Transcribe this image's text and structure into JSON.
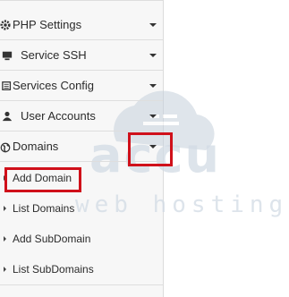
{
  "sidebar": {
    "items": [
      {
        "label": "PHP Settings",
        "icon": "gear-icon"
      },
      {
        "label": "Service SSH",
        "icon": "monitor-icon"
      },
      {
        "label": "Services Config",
        "icon": "server-icon"
      },
      {
        "label": "User Accounts",
        "icon": "user-icon"
      },
      {
        "label": "Domains",
        "icon": "globe-icon"
      }
    ],
    "domains_submenu": [
      {
        "label": "Add Domain"
      },
      {
        "label": "List Domains"
      },
      {
        "label": "Add SubDomain"
      },
      {
        "label": "List SubDomains"
      }
    ]
  },
  "watermark": {
    "brand": "accu",
    "tagline": "web hosting"
  },
  "colors": {
    "highlight": "#d0101a",
    "watermark": "#c9d3de"
  }
}
